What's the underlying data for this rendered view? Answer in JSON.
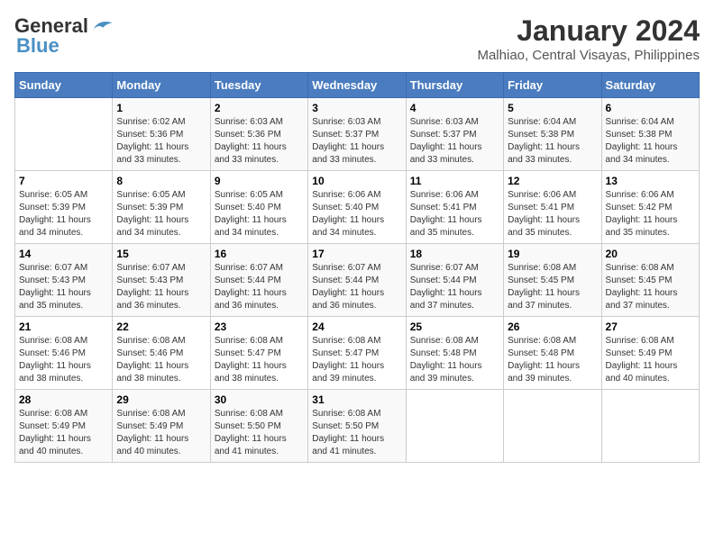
{
  "header": {
    "logo_line1": "General",
    "logo_line2": "Blue",
    "title": "January 2024",
    "subtitle": "Malhiao, Central Visayas, Philippines"
  },
  "calendar": {
    "days_of_week": [
      "Sunday",
      "Monday",
      "Tuesday",
      "Wednesday",
      "Thursday",
      "Friday",
      "Saturday"
    ],
    "weeks": [
      [
        {
          "num": "",
          "info": ""
        },
        {
          "num": "1",
          "info": "Sunrise: 6:02 AM\nSunset: 5:36 PM\nDaylight: 11 hours\nand 33 minutes."
        },
        {
          "num": "2",
          "info": "Sunrise: 6:03 AM\nSunset: 5:36 PM\nDaylight: 11 hours\nand 33 minutes."
        },
        {
          "num": "3",
          "info": "Sunrise: 6:03 AM\nSunset: 5:37 PM\nDaylight: 11 hours\nand 33 minutes."
        },
        {
          "num": "4",
          "info": "Sunrise: 6:03 AM\nSunset: 5:37 PM\nDaylight: 11 hours\nand 33 minutes."
        },
        {
          "num": "5",
          "info": "Sunrise: 6:04 AM\nSunset: 5:38 PM\nDaylight: 11 hours\nand 33 minutes."
        },
        {
          "num": "6",
          "info": "Sunrise: 6:04 AM\nSunset: 5:38 PM\nDaylight: 11 hours\nand 34 minutes."
        }
      ],
      [
        {
          "num": "7",
          "info": "Sunrise: 6:05 AM\nSunset: 5:39 PM\nDaylight: 11 hours\nand 34 minutes."
        },
        {
          "num": "8",
          "info": "Sunrise: 6:05 AM\nSunset: 5:39 PM\nDaylight: 11 hours\nand 34 minutes."
        },
        {
          "num": "9",
          "info": "Sunrise: 6:05 AM\nSunset: 5:40 PM\nDaylight: 11 hours\nand 34 minutes."
        },
        {
          "num": "10",
          "info": "Sunrise: 6:06 AM\nSunset: 5:40 PM\nDaylight: 11 hours\nand 34 minutes."
        },
        {
          "num": "11",
          "info": "Sunrise: 6:06 AM\nSunset: 5:41 PM\nDaylight: 11 hours\nand 35 minutes."
        },
        {
          "num": "12",
          "info": "Sunrise: 6:06 AM\nSunset: 5:41 PM\nDaylight: 11 hours\nand 35 minutes."
        },
        {
          "num": "13",
          "info": "Sunrise: 6:06 AM\nSunset: 5:42 PM\nDaylight: 11 hours\nand 35 minutes."
        }
      ],
      [
        {
          "num": "14",
          "info": "Sunrise: 6:07 AM\nSunset: 5:43 PM\nDaylight: 11 hours\nand 35 minutes."
        },
        {
          "num": "15",
          "info": "Sunrise: 6:07 AM\nSunset: 5:43 PM\nDaylight: 11 hours\nand 36 minutes."
        },
        {
          "num": "16",
          "info": "Sunrise: 6:07 AM\nSunset: 5:44 PM\nDaylight: 11 hours\nand 36 minutes."
        },
        {
          "num": "17",
          "info": "Sunrise: 6:07 AM\nSunset: 5:44 PM\nDaylight: 11 hours\nand 36 minutes."
        },
        {
          "num": "18",
          "info": "Sunrise: 6:07 AM\nSunset: 5:44 PM\nDaylight: 11 hours\nand 37 minutes."
        },
        {
          "num": "19",
          "info": "Sunrise: 6:08 AM\nSunset: 5:45 PM\nDaylight: 11 hours\nand 37 minutes."
        },
        {
          "num": "20",
          "info": "Sunrise: 6:08 AM\nSunset: 5:45 PM\nDaylight: 11 hours\nand 37 minutes."
        }
      ],
      [
        {
          "num": "21",
          "info": "Sunrise: 6:08 AM\nSunset: 5:46 PM\nDaylight: 11 hours\nand 38 minutes."
        },
        {
          "num": "22",
          "info": "Sunrise: 6:08 AM\nSunset: 5:46 PM\nDaylight: 11 hours\nand 38 minutes."
        },
        {
          "num": "23",
          "info": "Sunrise: 6:08 AM\nSunset: 5:47 PM\nDaylight: 11 hours\nand 38 minutes."
        },
        {
          "num": "24",
          "info": "Sunrise: 6:08 AM\nSunset: 5:47 PM\nDaylight: 11 hours\nand 39 minutes."
        },
        {
          "num": "25",
          "info": "Sunrise: 6:08 AM\nSunset: 5:48 PM\nDaylight: 11 hours\nand 39 minutes."
        },
        {
          "num": "26",
          "info": "Sunrise: 6:08 AM\nSunset: 5:48 PM\nDaylight: 11 hours\nand 39 minutes."
        },
        {
          "num": "27",
          "info": "Sunrise: 6:08 AM\nSunset: 5:49 PM\nDaylight: 11 hours\nand 40 minutes."
        }
      ],
      [
        {
          "num": "28",
          "info": "Sunrise: 6:08 AM\nSunset: 5:49 PM\nDaylight: 11 hours\nand 40 minutes."
        },
        {
          "num": "29",
          "info": "Sunrise: 6:08 AM\nSunset: 5:49 PM\nDaylight: 11 hours\nand 40 minutes."
        },
        {
          "num": "30",
          "info": "Sunrise: 6:08 AM\nSunset: 5:50 PM\nDaylight: 11 hours\nand 41 minutes."
        },
        {
          "num": "31",
          "info": "Sunrise: 6:08 AM\nSunset: 5:50 PM\nDaylight: 11 hours\nand 41 minutes."
        },
        {
          "num": "",
          "info": ""
        },
        {
          "num": "",
          "info": ""
        },
        {
          "num": "",
          "info": ""
        }
      ]
    ]
  }
}
